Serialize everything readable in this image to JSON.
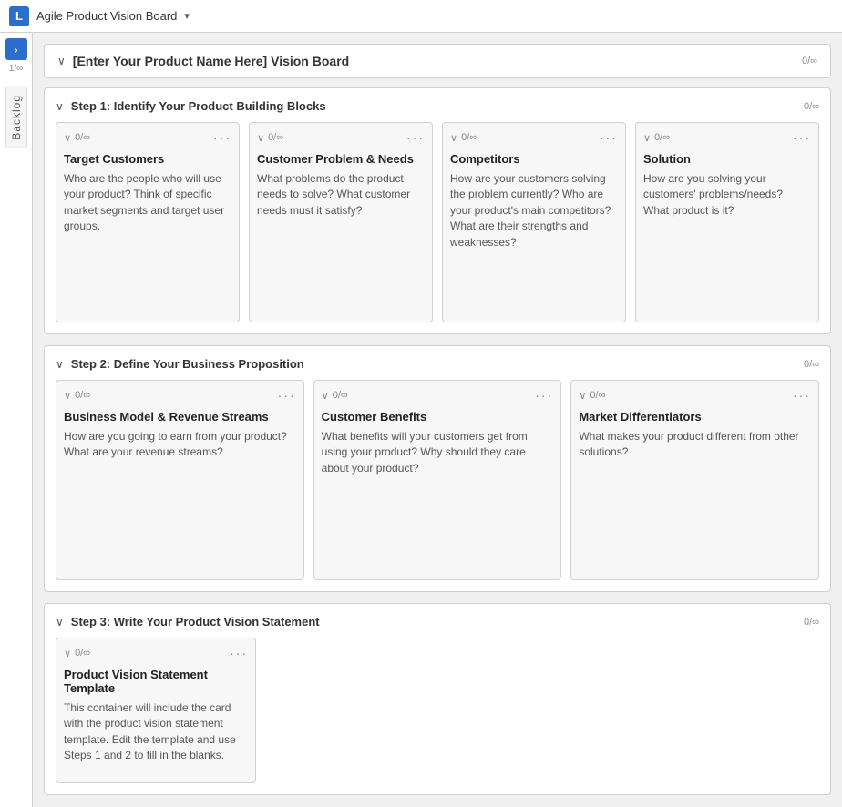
{
  "topbar": {
    "app_letter": "L",
    "title": "Agile Product Vision Board",
    "caret": "▾"
  },
  "left_panel": {
    "arrow": "›",
    "counter": "1/∞",
    "backlog": "Backlog"
  },
  "board": {
    "title": "[Enter Your Product Name Here] Vision Board",
    "count": "0/∞"
  },
  "sections": [
    {
      "id": "step1",
      "title": "Step 1: Identify Your Product Building Blocks",
      "count": "0/∞",
      "grid": "4",
      "cards": [
        {
          "id": "target-customers",
          "count": "0/∞",
          "title": "Target Customers",
          "description": "Who are the people who will use your product? Think of specific market segments and target user groups."
        },
        {
          "id": "customer-problem",
          "count": "0/∞",
          "title": "Customer Problem & Needs",
          "description": "What problems do the product needs to solve? What customer needs must it satisfy?"
        },
        {
          "id": "competitors",
          "count": "0/∞",
          "title": "Competitors",
          "description": "How are your customers solving the problem currently? Who are your product's main competitors? What are their strengths and weaknesses?"
        },
        {
          "id": "solution",
          "count": "0/∞",
          "title": "Solution",
          "description": "How are you solving your customers' problems/needs? What product is it?"
        }
      ]
    },
    {
      "id": "step2",
      "title": "Step 2: Define Your Business Proposition",
      "count": "0/∞",
      "grid": "3",
      "cards": [
        {
          "id": "business-model",
          "count": "0/∞",
          "title": "Business Model & Revenue Streams",
          "description": "How are you going to earn from your product? What are your revenue streams?"
        },
        {
          "id": "customer-benefits",
          "count": "0/∞",
          "title": "Customer Benefits",
          "description": "What benefits will your customers get from using your product? Why should they care about your product?"
        },
        {
          "id": "market-differentiators",
          "count": "0/∞",
          "title": "Market Differentiators",
          "description": "What makes your product different from other solutions?"
        }
      ]
    },
    {
      "id": "step3",
      "title": "Step 3: Write Your Product Vision Statement",
      "count": "0/∞",
      "grid": "1",
      "cards": [
        {
          "id": "product-vision-statement",
          "count": "0/∞",
          "title": "Product Vision Statement Template",
          "description": "This container will include the card with the product vision statement template. Edit the template and use Steps 1 and 2 to fill in the blanks."
        }
      ]
    }
  ]
}
